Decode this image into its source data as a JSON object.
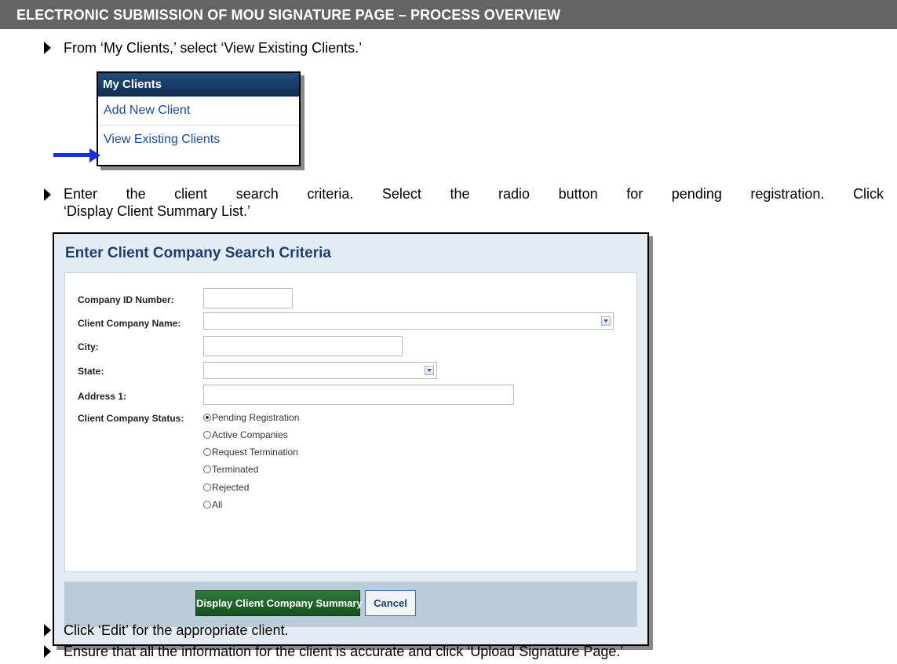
{
  "header": {
    "title": "ELECTRONIC SUBMISSION OF MOU SIGNATURE PAGE – PROCESS OVERVIEW"
  },
  "steps": [
    "From ‘My Clients,’ select ‘View Existing Clients.’",
    "Enter the client search criteria. Select the radio button for pending registration. Click",
    "‘Display Client Summary List.’",
    "Click ‘Edit’ for the appropriate client.",
    "Ensure that all the information for the client is accurate and click ‘Upload Signature Page.’"
  ],
  "menu": {
    "title": "My Clients",
    "items": [
      "Add New Client",
      "View Existing Clients"
    ],
    "arrow_color": "#1a2fe0"
  },
  "search": {
    "title": "Enter Client Company Search Criteria",
    "fields": {
      "company_id_label": "Company ID Number:",
      "company_name_label": "Client Company Name:",
      "city_label": "City:",
      "state_label": "State:",
      "address_label": "Address 1:",
      "status_label": "Client Company Status:"
    },
    "status_options": [
      "Pending Registration",
      "Active Companies",
      "Request Termination",
      "Terminated",
      "Rejected",
      "All"
    ],
    "selected_status": "Pending Registration",
    "submit_label": "Display Client Company Summary List",
    "cancel_label": "Cancel"
  },
  "colors": {
    "header": "#636466",
    "link": "#1a4aa0",
    "primary_button": "#1e6a2e",
    "panel_title": "#1d3f6d"
  }
}
